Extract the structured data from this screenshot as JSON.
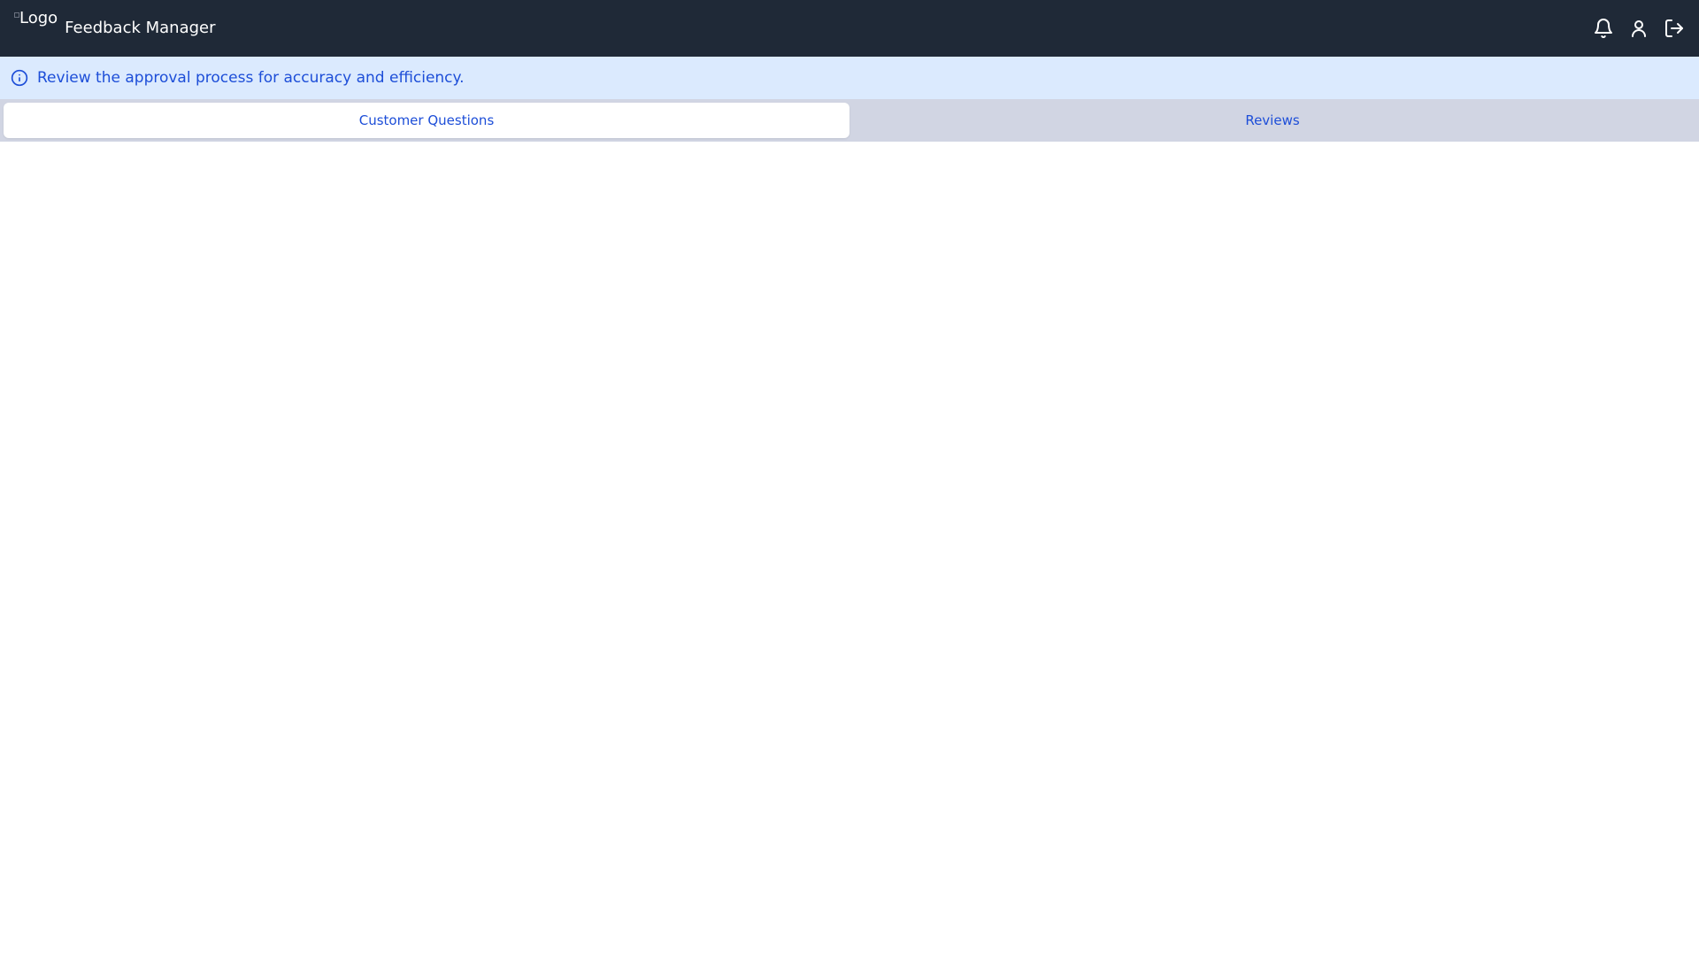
{
  "header": {
    "logo_alt": "Logo",
    "title": "Feedback Manager",
    "actions": [
      {
        "icon": "bell-icon"
      },
      {
        "icon": "user-icon"
      },
      {
        "icon": "logout-icon"
      }
    ]
  },
  "banner": {
    "icon": "info-icon",
    "message": "Review the approval process for accuracy and efficiency."
  },
  "tabs": [
    {
      "label": "Customer Questions",
      "active": true
    },
    {
      "label": "Reviews",
      "active": false
    }
  ],
  "colors": {
    "header_bg": "#1f2937",
    "banner_bg": "#dbeafe",
    "accent": "#1d4ed8",
    "tabs_bg": "#d1d5e3"
  }
}
